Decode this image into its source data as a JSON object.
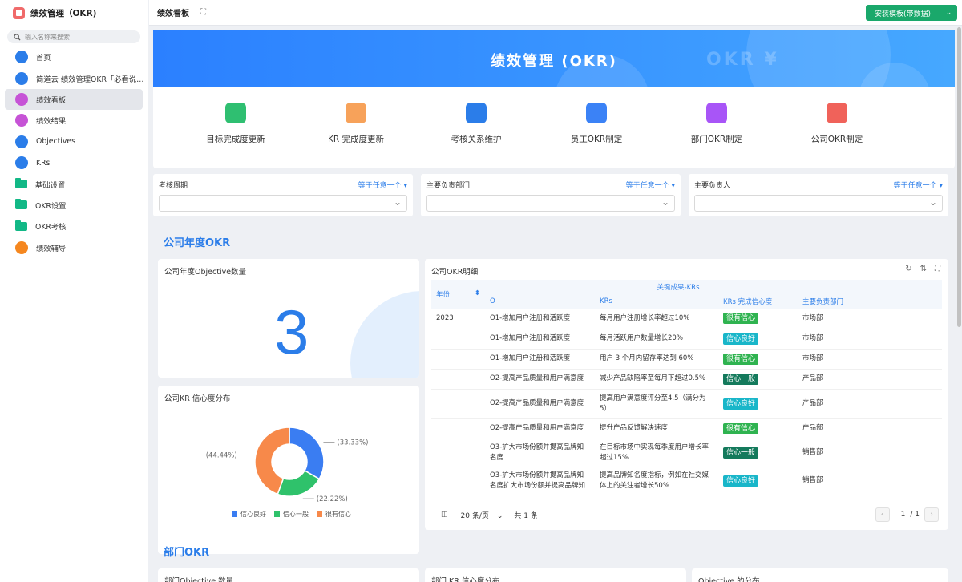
{
  "app": {
    "title": "绩效管理（OKR)"
  },
  "sidebar": {
    "search_placeholder": "输入名称来搜索",
    "items": [
      {
        "label": "首页",
        "icon": "home-icon",
        "color": "#2b7de9",
        "active": false
      },
      {
        "label": "简道云 绩效管理OKR「必看说…",
        "icon": "document-icon",
        "color": "#2b7de9",
        "active": false
      },
      {
        "label": "绩效看板",
        "icon": "dashboard-icon",
        "color": "#c653d6",
        "active": true
      },
      {
        "label": "绩效结果",
        "icon": "result-icon",
        "color": "#c653d6",
        "active": false
      },
      {
        "label": "Objectives",
        "icon": "target-icon",
        "color": "#2b7de9",
        "active": false
      },
      {
        "label": "KRs",
        "icon": "bookmark-icon",
        "color": "#2b7de9",
        "active": false
      },
      {
        "label": "基础设置",
        "icon": "folder-icon",
        "color": "#12b886",
        "active": false
      },
      {
        "label": "OKR设置",
        "icon": "folder-icon",
        "color": "#12b886",
        "active": false
      },
      {
        "label": "OKR考核",
        "icon": "folder-icon",
        "color": "#12b886",
        "active": false
      },
      {
        "label": "绩效辅导",
        "icon": "coaching-icon",
        "color": "#f5871f",
        "active": false
      }
    ]
  },
  "topbar": {
    "tab": "绩效看板",
    "install_label": "安装模板(带数据)"
  },
  "banner": {
    "title": "绩效管理 (OKR)",
    "deco": "OKR  ¥"
  },
  "quick_links": [
    {
      "label": "目标完成度更新",
      "icon": "flag-icon",
      "color": "#2fbf71"
    },
    {
      "label": "KR 完成度更新",
      "icon": "mail-icon",
      "color": "#f7a25a"
    },
    {
      "label": "考核关系维护",
      "icon": "user-download-icon",
      "color": "#2b7de9"
    },
    {
      "label": "员工OKR制定",
      "icon": "form-icon",
      "color": "#3b82f6"
    },
    {
      "label": "部门OKR制定",
      "icon": "chart-icon",
      "color": "#a855f7"
    },
    {
      "label": "公司OKR制定",
      "icon": "building-icon",
      "color": "#f0625a"
    }
  ],
  "filters": [
    {
      "label": "考核周期",
      "op": "等于任意一个 ▾"
    },
    {
      "label": "主要负责部门",
      "op": "等于任意一个 ▾"
    },
    {
      "label": "主要负责人",
      "op": "等于任意一个 ▾"
    }
  ],
  "sections": {
    "company": "公司年度OKR",
    "dept": "部门OKR"
  },
  "obj_card": {
    "title": "公司年度Objective数量",
    "value": "3"
  },
  "pie_card": {
    "title": "公司KR 信心度分布"
  },
  "chart_data": {
    "type": "pie",
    "donut": true,
    "series": [
      {
        "name": "信心良好",
        "value": 33.33,
        "label": "(33.33%)",
        "color": "#3a7df2"
      },
      {
        "name": "信心一般",
        "value": 22.22,
        "label": "(22.22%)",
        "color": "#2fc26b"
      },
      {
        "name": "很有信心",
        "value": 44.44,
        "label": "(44.44%)",
        "color": "#f7894a"
      }
    ],
    "legend": "bottom"
  },
  "table_card": {
    "title": "公司OKR明细",
    "group_header": "关键成果-KRs",
    "columns": [
      "年份",
      "O",
      "KRs",
      "KRs 完成信心度",
      "主要负责部门"
    ],
    "year": "2023",
    "rows": [
      {
        "o": "O1-增加用户注册和活跃度",
        "kr": "每月用户注册增长率超过10%",
        "conf": "很有信心",
        "dept": "市场部"
      },
      {
        "o": "O1-增加用户注册和活跃度",
        "kr": "每月活跃用户数量增长20%",
        "conf": "信心良好",
        "dept": "市场部"
      },
      {
        "o": "O1-增加用户注册和活跃度",
        "kr": "用户 3 个月内留存率达到 60%",
        "conf": "很有信心",
        "dept": "市场部"
      },
      {
        "o": "O2-提高产品质量和用户满意度",
        "kr": "减少产品缺陷率至每月下超过0.5%",
        "conf": "信心一般",
        "dept": "产品部"
      },
      {
        "o": "O2-提高产品质量和用户满意度",
        "kr": "提高用户满意度评分至4.5（满分为5）",
        "conf": "信心良好",
        "dept": "产品部"
      },
      {
        "o": "O2-提高产品质量和用户满意度",
        "kr": "提升产品反馈解决速度",
        "conf": "很有信心",
        "dept": "产品部"
      },
      {
        "o": "O3-扩大市场份额并提高品牌知名度",
        "kr": "在目标市场中实现每季度用户增长率超过15%",
        "conf": "信心一般",
        "dept": "销售部"
      },
      {
        "o": "O3-扩大市场份额并提高品牌知名度扩大市场份额并提高品牌知",
        "kr": "提高品牌知名度指标，例如在社交媒体上的关注者增长50%",
        "conf": "信心良好",
        "dept": "销售部"
      }
    ],
    "badge_colors": {
      "很有信心": "#2fb350",
      "信心良好": "#19b6c9",
      "信心一般": "#147a5c"
    },
    "pager": {
      "page_size": "20 条/页",
      "total": "共 1 条",
      "page": "1",
      "pages": "/ 1"
    }
  },
  "dept_cards": [
    "部门Objective 数量",
    "部门 KR 信心度分布",
    "Objective 的分布"
  ]
}
